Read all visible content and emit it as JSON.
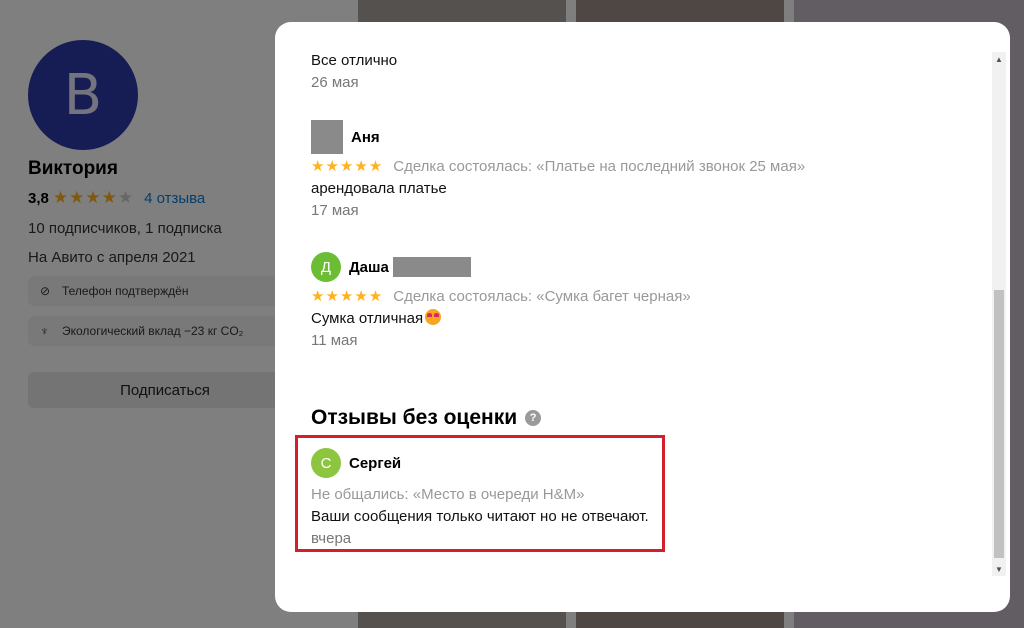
{
  "profile": {
    "avatar_letter": "В",
    "name": "Виктория",
    "rating": "3,8",
    "stars_filled": 4,
    "stars_total": 5,
    "reviews_link": "4 отзыва",
    "followers": "10 подписчиков, 1 подписка",
    "since": "На Авито с апреля 2021",
    "badges": [
      {
        "icon": "check-circle-icon",
        "label": "Телефон подтверждён"
      },
      {
        "icon": "eco-icon",
        "label": "Экологический вклад −23 кг CO₂"
      }
    ],
    "subscribe_label": "Подписаться"
  },
  "modal": {
    "reviews": [
      {
        "text": "Все отлично",
        "date": "26 мая"
      },
      {
        "author": "Аня",
        "avatar_type": "redacted",
        "stars": "★★★★★",
        "deal": "Сделка состоялась: «Платье на последний звонок 25 мая»",
        "text": "арендовала платье",
        "date": "17 мая"
      },
      {
        "author": "Даша",
        "avatar_letter": "Д",
        "stars": "★★★★★",
        "deal": "Сделка состоялась: «Сумка багет черная»",
        "text": "Сумка отличная",
        "date": "11 мая"
      }
    ],
    "unrated_section": {
      "title": "Отзывы без оценки",
      "help_icon": "?",
      "review": {
        "author": "Сергей",
        "avatar_letter": "С",
        "deal": "Не общались: «Место в очереди H&M»",
        "text": "Ваши сообщения только читают но не отвечают.",
        "date": "вчера"
      }
    },
    "scrollbar": {
      "up_arrow": "▲",
      "down_arrow": "▼"
    }
  },
  "colors": {
    "star": "#ffb21e",
    "link": "#0a7cd8",
    "highlight": "#d21f2b",
    "profile_avatar": "#2d3aa8"
  }
}
